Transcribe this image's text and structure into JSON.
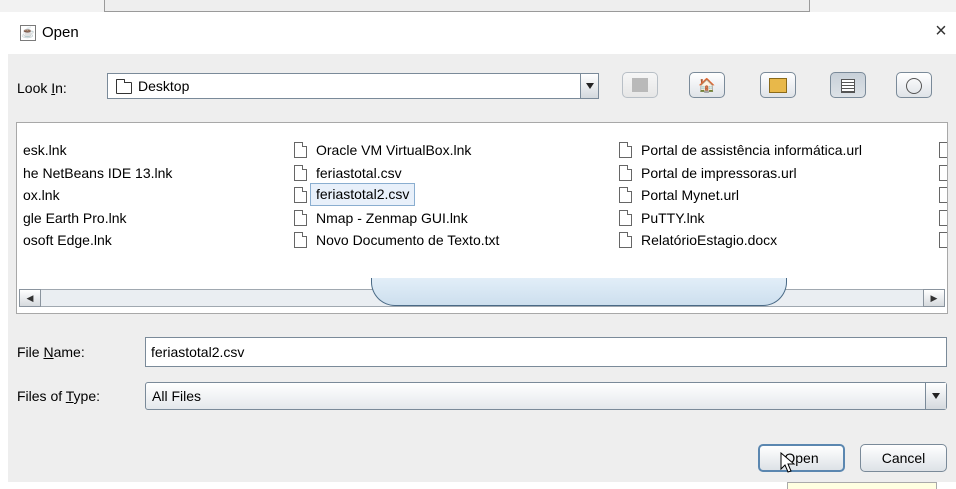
{
  "dialog": {
    "title": "Open",
    "close_glyph": "×"
  },
  "look_in": {
    "label": "Look In:",
    "value": "Desktop"
  },
  "toolbar": {
    "buttons": [
      "up-one-level-icon",
      "home-icon",
      "new-folder-icon",
      "list-view-icon",
      "details-view-icon"
    ]
  },
  "files": {
    "col1": [
      "esk.lnk",
      "he NetBeans IDE 13.lnk",
      "ox.lnk",
      "gle Earth Pro.lnk",
      "osoft Edge.lnk"
    ],
    "col2": [
      "Oracle VM VirtualBox.lnk",
      "feriastotal.csv",
      "feriastotal2.csv",
      "Nmap - Zenmap GUI.lnk",
      "Novo Documento de Texto.txt"
    ],
    "col3": [
      "Portal de assistência informática.url",
      "Portal de impressoras.url",
      "Portal Mynet.url",
      "PuTTY.lnk",
      "RelatórioEstagio.docx"
    ],
    "selected": "feriastotal2.csv"
  },
  "file_name": {
    "label": "File Name:",
    "value": "feriastotal2.csv"
  },
  "file_type": {
    "label": "Files of Type:",
    "value": "All Files"
  },
  "buttons": {
    "open": "Open",
    "cancel": "Cancel"
  }
}
